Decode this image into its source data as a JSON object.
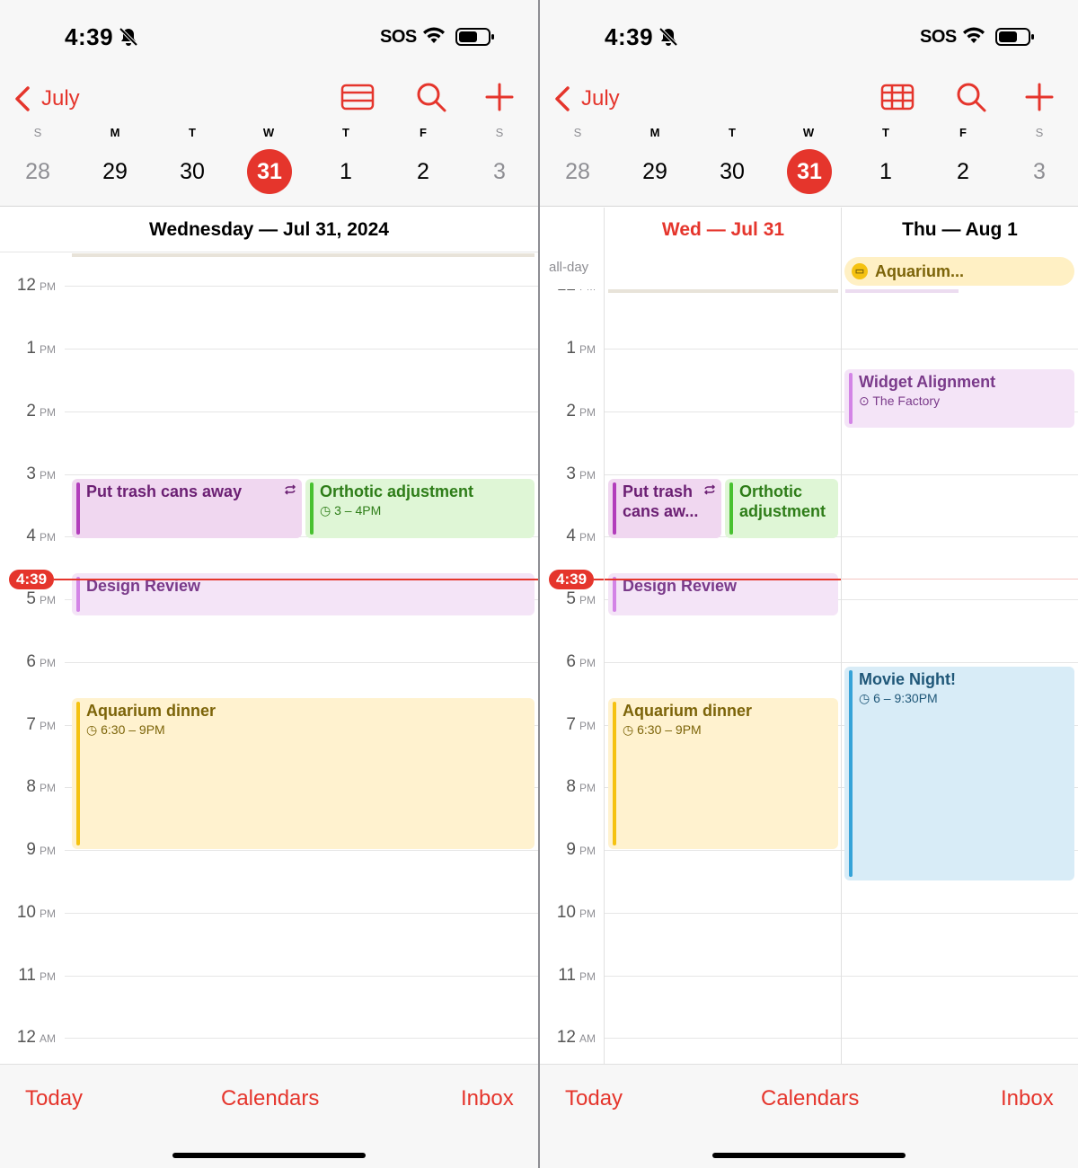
{
  "status": {
    "time": "4:39",
    "carrier": "SOS"
  },
  "nav": {
    "back_label": "July"
  },
  "week": {
    "days": [
      {
        "dow": "S",
        "date": "28"
      },
      {
        "dow": "M",
        "date": "29"
      },
      {
        "dow": "T",
        "date": "30"
      },
      {
        "dow": "W",
        "date": "31"
      },
      {
        "dow": "T",
        "date": "1"
      },
      {
        "dow": "F",
        "date": "2"
      },
      {
        "dow": "S",
        "date": "3"
      }
    ]
  },
  "hours": [
    {
      "h": "12",
      "p": "PM"
    },
    {
      "h": "1",
      "p": "PM"
    },
    {
      "h": "2",
      "p": "PM"
    },
    {
      "h": "3",
      "p": "PM"
    },
    {
      "h": "4",
      "p": "PM"
    },
    {
      "h": "5",
      "p": "PM"
    },
    {
      "h": "6",
      "p": "PM"
    },
    {
      "h": "7",
      "p": "PM"
    },
    {
      "h": "8",
      "p": "PM"
    },
    {
      "h": "9",
      "p": "PM"
    },
    {
      "h": "10",
      "p": "PM"
    },
    {
      "h": "11",
      "p": "PM"
    },
    {
      "h": "12",
      "p": "AM"
    }
  ],
  "now_time": "4:39",
  "left": {
    "day_header": "Wednesday — Jul 31, 2024",
    "events": {
      "trash": {
        "title": "Put trash cans away"
      },
      "orthotic": {
        "title": "Orthotic adjustment",
        "time": "3 – 4PM"
      },
      "design": {
        "title": "Design Review"
      },
      "aquarium": {
        "title": "Aquarium dinner",
        "time": "6:30 – 9PM"
      }
    }
  },
  "right": {
    "col1_header": "Wed — Jul 31",
    "col2_header": "Thu — Aug 1",
    "allday_label": "all-day",
    "allday_event": "Aquarium...",
    "events": {
      "trash": {
        "title_l1": "Put trash",
        "title_l2": "cans aw..."
      },
      "orthotic": {
        "title_l1": "Orthotic",
        "title_l2": "adjustment"
      },
      "design": {
        "title": "Design Review"
      },
      "aquarium": {
        "title": "Aquarium dinner",
        "time": "6:30 – 9PM"
      },
      "widget": {
        "title": "Widget Alignment",
        "location": "The Factory"
      },
      "movie": {
        "title": "Movie Night!",
        "time": "6 – 9:30PM"
      }
    }
  },
  "tabs": {
    "today": "Today",
    "calendars": "Calendars",
    "inbox": "Inbox"
  },
  "colors": {
    "accent": "#e5352c"
  }
}
